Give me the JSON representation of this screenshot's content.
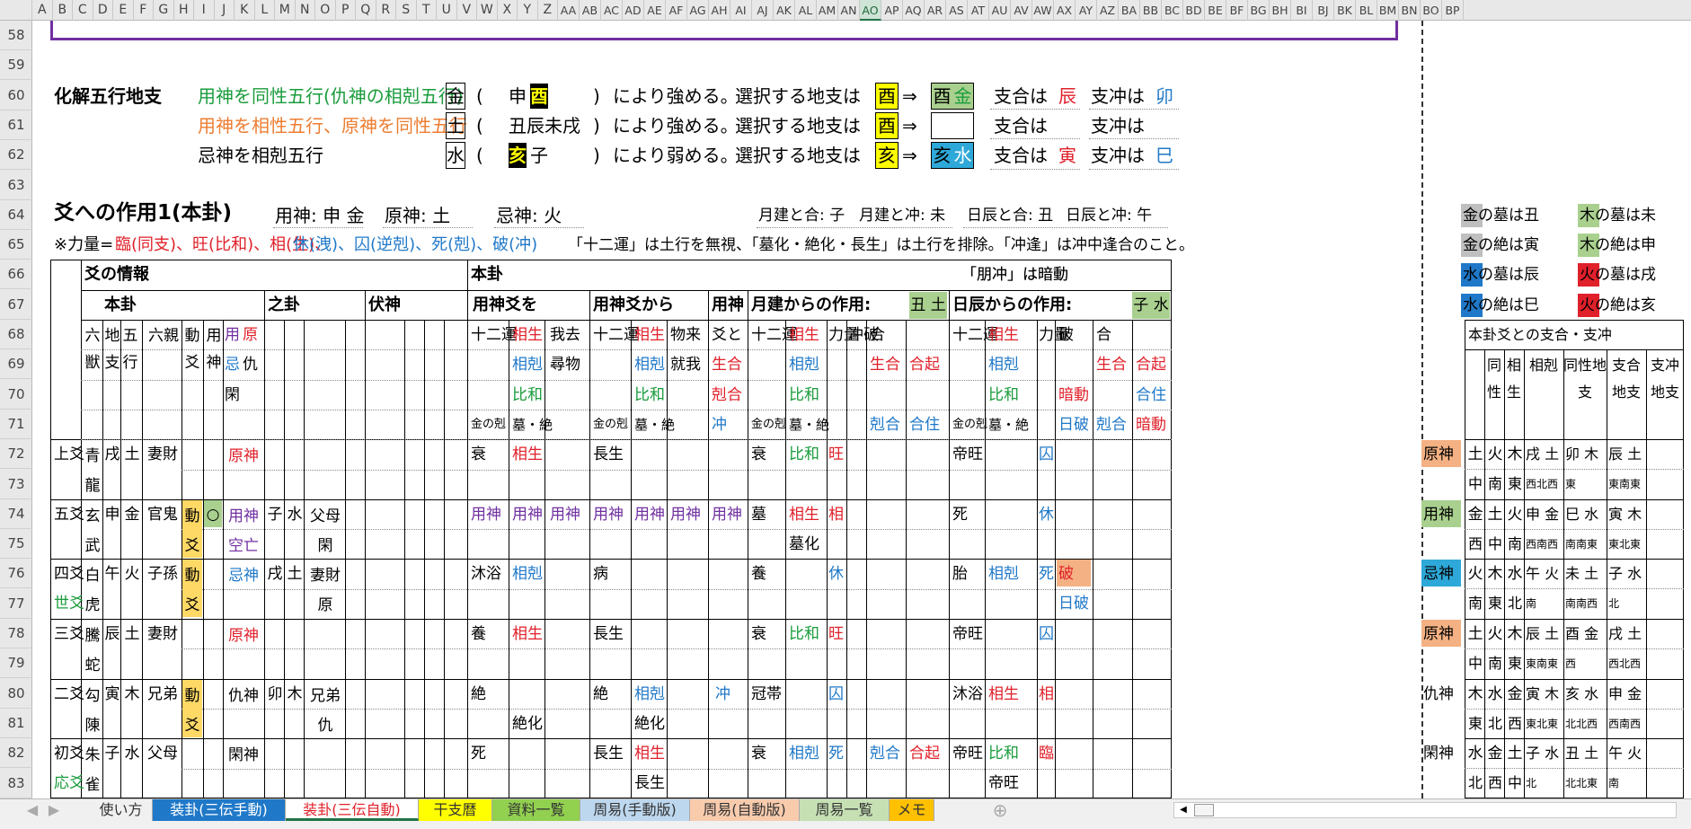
{
  "columns": [
    "A",
    "B",
    "C",
    "D",
    "E",
    "F",
    "G",
    "H",
    "I",
    "J",
    "K",
    "L",
    "M",
    "N",
    "O",
    "P",
    "Q",
    "R",
    "S",
    "T",
    "U",
    "V",
    "W",
    "X",
    "Y",
    "Z",
    "AA",
    "AB",
    "AC",
    "AD",
    "AE",
    "AF",
    "AG",
    "AH",
    "AI",
    "AJ",
    "AK",
    "AL",
    "AM",
    "AN",
    "AO",
    "AP",
    "AQ",
    "AR",
    "AS",
    "AT",
    "AU",
    "AV",
    "AW",
    "AX",
    "AY",
    "AZ",
    "BA",
    "BB",
    "BC",
    "BD",
    "BE",
    "BF",
    "BG",
    "BH",
    "BI",
    "BJ",
    "BK",
    "BL",
    "BM",
    "BN",
    "BO",
    "BP"
  ],
  "selected_column": "AO",
  "rows": [
    "58",
    "59",
    "60",
    "61",
    "62",
    "63",
    "64",
    "65",
    "66",
    "67",
    "68",
    "69",
    "70",
    "71",
    "72",
    "73",
    "74",
    "75",
    "76",
    "77",
    "78",
    "79",
    "80",
    "81",
    "82",
    "83"
  ],
  "colors": {
    "purple": "#7030a0",
    "red": "#e0202a",
    "green": "#1a9c3c",
    "blue": "#1f78c8",
    "orange": "#ed7d31",
    "yellow": "#ffff00",
    "light_green": "#a9d08e",
    "peach": "#f4b183",
    "gray": "#bfbfbf",
    "excel_green": "#217346"
  },
  "henka": {
    "title": "化解五行地支",
    "lines": [
      {
        "rule": "用神を同性五行(仇神の相剋五行)",
        "elem": "金",
        "paren_open": "(",
        "branches": [
          "申",
          "酉"
        ],
        "paren_close": ")",
        "effect": "により強める。",
        "choose": "選択する地支は",
        "pick": "酉",
        "arrow": "⇒",
        "res": [
          "酉",
          "金"
        ],
        "he_label": "支合は",
        "he": "辰",
        "chong_label": "支冲は",
        "chong": "卯"
      },
      {
        "rule": "用神を相性五行、原神を同性五行",
        "elem": "土",
        "paren_open": "(",
        "branches": [
          "丑辰未戌"
        ],
        "paren_close": ")",
        "effect": "により強める。",
        "choose": "選択する地支は",
        "pick": "酉",
        "arrow": "⇒",
        "res": [],
        "he_label": "支合は",
        "he": "",
        "chong_label": "支冲は",
        "chong": ""
      },
      {
        "rule": "忌神を相剋五行",
        "elem": "水",
        "paren_open": "(",
        "branches": [
          "亥",
          "子"
        ],
        "paren_close": ")",
        "effect": "により弱める。",
        "choose": "選択する地支は",
        "pick": "亥",
        "arrow": "⇒",
        "res": [
          "亥",
          "水"
        ],
        "he_label": "支合は",
        "he": "寅",
        "chong_label": "支冲は",
        "chong": "巳"
      }
    ]
  },
  "sakuyo": {
    "title": "爻への作用1(本卦)",
    "yojin": "用神: 申 金",
    "genjin": "原神: 土",
    "kijin": "忌神: 火",
    "month_he": "月建と合: 子",
    "month_chong": "月建と冲: 未",
    "day_he": "日辰と合: 丑",
    "day_chong": "日辰と冲: 午",
    "rikiryo_prefix": "※力量=",
    "rikiryo_red": "臨(同支)、旺(比和)、相(生)、",
    "rikiryo_blue": "休(洩)、囚(逆剋)、死(剋)、破(冲)",
    "note1": "「十二運」は土行を無視、「墓化・絶化・長生」は土行を排除。「冲逢」は冲中逢合のこと。",
    "note2": "「朋冲」は暗動"
  },
  "header": {
    "kou_info": "爻の情報",
    "honka": "本卦",
    "shika": "之卦",
    "fukushin": "伏神",
    "honka2": "本卦",
    "yojin_kou_wo": "用神爻を",
    "yojin_kou_kara": "用神爻から",
    "yojin": "用神",
    "getsuken": "月建からの作用:",
    "getsuken_val": "丑 土",
    "nisshin": "日辰からの作用:",
    "nisshin_val": "子 水",
    "rokuju": "六獣",
    "chishi": "地支",
    "gogyo": "五行",
    "rokushin": "六親",
    "dokou": "動爻",
    "yojin_col": "用神",
    "yo": "用",
    "gen": "原",
    "ki": "忌",
    "kyu": "仇",
    "kan": "閑",
    "juniun": "十二運",
    "kinnokoku": "金の剋",
    "sosho": "相生",
    "sokoku": "相剋",
    "hiwa": "比和",
    "bo_zetsu": "墓・絶",
    "gakyo": "我去",
    "juga": "尋物",
    "raiga": "物来",
    "shuga": "就我",
    "kouto": "爻と",
    "seigo": "生合",
    "kokugo": "剋合",
    "chu": "冲",
    "rikiryo": "力量",
    "chuha": "冲破",
    "go": "合",
    "goki": "合起",
    "kokuju": "剋合",
    "goju": "合住",
    "ha": "破",
    "ando": "暗動",
    "nippa": "日破"
  },
  "table_rows": [
    {
      "kou": "上爻",
      "sub": "",
      "beast": "青龍",
      "branch": "戌",
      "elem": "土",
      "rel": "妻財",
      "dong": "",
      "yong": "",
      "role": "原神",
      "role_color": "red",
      "r1": "衰",
      "r2": "相生",
      "m1": "長生",
      "m2": "",
      "m3": "",
      "mo1": "衰",
      "mo2": "比和",
      "mo3": "旺",
      "d1": "帝旺",
      "d2": "",
      "d3": "囚",
      "d4": ""
    },
    {
      "kou": "五爻",
      "sub": "",
      "beast": "玄武",
      "branch": "申",
      "elem": "金",
      "rel": "官鬼",
      "dong": "動爻",
      "yong": "○",
      "role": "用神空亡",
      "role_color": "purple",
      "zi_b": "子",
      "zi_e": "水",
      "zi_r": "父母閑",
      "r1": "用神",
      "r2": "用神",
      "r2b": "用神",
      "m1": "用神",
      "m2": "用神",
      "m3": "用神",
      "m4": "用神",
      "mo1": "墓",
      "mo2": "相生",
      "mo2b": "墓化",
      "mo3": "相",
      "d1": "死",
      "d2": "",
      "d3": "休",
      "d4": ""
    },
    {
      "kou": "四爻",
      "sub": "世爻",
      "beast": "白虎",
      "branch": "午",
      "elem": "火",
      "rel": "子孫",
      "dong": "動爻",
      "yong": "",
      "role": "忌神",
      "role_color": "blue",
      "zi_b": "戌",
      "zi_e": "土",
      "zi_r": "妻財原",
      "r1": "沐浴",
      "r2": "相剋",
      "m1": "病",
      "mo1": "養",
      "mo3": "休",
      "d1": "胎",
      "d2": "相剋",
      "d3": "死",
      "d4": "破",
      "d5": "日破"
    },
    {
      "kou": "三爻",
      "sub": "",
      "beast": "騰蛇",
      "branch": "辰",
      "elem": "土",
      "rel": "妻財",
      "dong": "",
      "yong": "",
      "role": "原神",
      "role_color": "red",
      "r1": "養",
      "r2": "相生",
      "m1": "長生",
      "mo1": "衰",
      "mo2": "比和",
      "mo3": "旺",
      "d1": "帝旺",
      "d3": "囚"
    },
    {
      "kou": "二爻",
      "sub": "",
      "beast": "勾陳",
      "branch": "寅",
      "elem": "木",
      "rel": "兄弟",
      "dong": "動爻",
      "yong": "",
      "role": "仇神",
      "role_color": "black",
      "zi_b": "卯",
      "zi_e": "木",
      "zi_r": "兄弟仇",
      "r1": "絶",
      "r1b": "絶化",
      "m1": "絶",
      "m2": "相剋",
      "m2b": "絶化",
      "chu": "冲",
      "mo1": "冠帯",
      "mo3": "囚",
      "d1": "沐浴",
      "d2": "相生",
      "d3": "相"
    },
    {
      "kou": "初爻",
      "sub": "応爻",
      "beast": "朱雀",
      "branch": "子",
      "elem": "水",
      "rel": "父母",
      "dong": "",
      "yong": "",
      "role": "閑神",
      "role_color": "black",
      "r1": "死",
      "m1": "長生",
      "m2": "相生",
      "m2b": "長生",
      "mo1": "衰",
      "mo2": "相剋",
      "mo3": "死",
      "mo4": "剋合",
      "mo5": "合起",
      "d1": "帝旺",
      "d2": "比和",
      "d2b": "帝旺",
      "d3": "臨"
    }
  ],
  "legend": [
    {
      "text": "金の墓は丑",
      "mark": "金",
      "color": "gray"
    },
    {
      "text": "木の墓は未",
      "mark": "木",
      "color": "light_green"
    },
    {
      "text": "金の絶は寅",
      "mark": "金",
      "color": "gray"
    },
    {
      "text": "木の絶は申",
      "mark": "木",
      "color": "light_green"
    },
    {
      "text": "水の墓は辰",
      "mark": "水",
      "color": "blue"
    },
    {
      "text": "火の墓は戌",
      "mark": "火",
      "color": "red"
    },
    {
      "text": "水の絶は巳",
      "mark": "水",
      "color": "blue"
    },
    {
      "text": "火の絶は亥",
      "mark": "火",
      "color": "red"
    }
  ],
  "right_table": {
    "title": "本卦爻との支合・支冲",
    "cols": [
      "同性",
      "相生",
      "相剋",
      "同性地支",
      "支合地支",
      "支冲地支"
    ],
    "rows": [
      {
        "role": "原神",
        "c1": "土",
        "c2": "火",
        "c3": "木",
        "c4": "戌 土",
        "c5": "卯 木",
        "c6": "辰 土",
        "s1": "中",
        "s2": "南",
        "s3": "東",
        "s4": "西北西",
        "s5": "東",
        "s6": "東南東"
      },
      {
        "role": "用神",
        "c1": "金",
        "c2": "土",
        "c3": "火",
        "c4": "申 金",
        "c5": "巳 水",
        "c6": "寅 木",
        "s1": "西",
        "s2": "中",
        "s3": "南",
        "s4": "西南西",
        "s5": "南南東",
        "s6": "東北東"
      },
      {
        "role": "忌神",
        "c1": "火",
        "c2": "木",
        "c3": "水",
        "c4": "午 火",
        "c5": "未 土",
        "c6": "子 水",
        "s1": "南",
        "s2": "東",
        "s3": "北",
        "s4": "南",
        "s5": "南南西",
        "s6": "北"
      },
      {
        "role": "原神",
        "c1": "土",
        "c2": "火",
        "c3": "木",
        "c4": "辰 土",
        "c5": "酉 金",
        "c6": "戌 土",
        "s1": "中",
        "s2": "南",
        "s3": "東",
        "s4": "東南東",
        "s5": "西",
        "s6": "西北西"
      },
      {
        "role": "仇神",
        "c1": "木",
        "c2": "水",
        "c3": "金",
        "c4": "寅 木",
        "c5": "亥 水",
        "c6": "申 金",
        "s1": "東",
        "s2": "北",
        "s3": "西",
        "s4": "東北東",
        "s5": "北北西",
        "s6": "西南西"
      },
      {
        "role": "閑神",
        "c1": "水",
        "c2": "金",
        "c3": "土",
        "c4": "子 水",
        "c5": "丑 土",
        "c6": "午 火",
        "s1": "北",
        "s2": "西",
        "s3": "中",
        "s4": "北",
        "s5": "北北東",
        "s6": "南"
      }
    ]
  },
  "tabs": [
    {
      "label": "使い方",
      "color": "#f0f0f0",
      "text": "#333"
    },
    {
      "label": "装卦(三伝手動)",
      "color": "#1f78c8",
      "text": "#ffffff"
    },
    {
      "label": "装卦(三伝自動)",
      "color": "#ffffff",
      "text": "#e0202a"
    },
    {
      "label": "干支暦",
      "color": "#ffff00",
      "text": "#333"
    },
    {
      "label": "資料一覧",
      "color": "#92d050",
      "text": "#333"
    },
    {
      "label": "周易(手動版)",
      "color": "#bdd7ee",
      "text": "#333"
    },
    {
      "label": "周易(自動版)",
      "color": "#f8cbad",
      "text": "#333"
    },
    {
      "label": "周易一覧",
      "color": "#c6e0b4",
      "text": "#333"
    },
    {
      "label": "メモ",
      "color": "#ffc000",
      "text": "#333"
    }
  ]
}
